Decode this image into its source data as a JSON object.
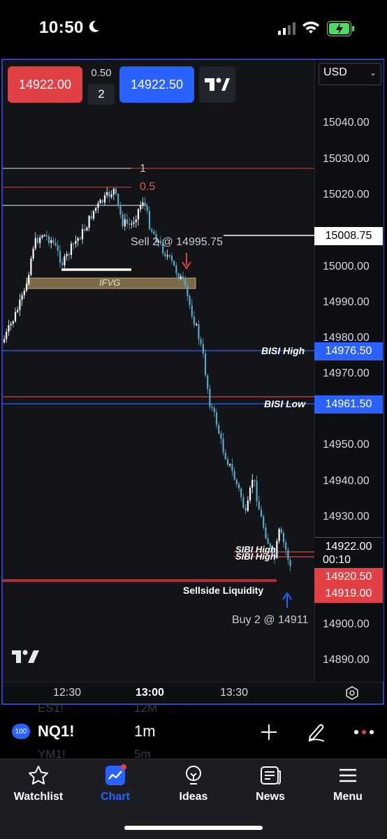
{
  "status_bar": {
    "time": "10:50"
  },
  "trade_panel": {
    "sell_price": "14922.00",
    "spread": "0.50",
    "quantity": "2",
    "buy_price": "14922.50",
    "currency": "USD"
  },
  "price_axis": {
    "ticks": [
      "15040.00",
      "15030.00",
      "15020.00",
      "15000.00",
      "14990.00",
      "14980.00",
      "14970.00",
      "14950.00",
      "14940.00",
      "14930.00",
      "14900.00",
      "14890.00"
    ],
    "last_price": "15008.75",
    "bisi_high_price": "14976.50",
    "bisi_low_price": "14961.50",
    "current_price": "14922.00",
    "countdown": "00:10",
    "sell_price_tag": "14920.50",
    "buy_price_tag": "14919.00"
  },
  "time_axis": {
    "ticks": [
      "12:30",
      "13:00",
      "13:30"
    ]
  },
  "annotations": {
    "fib_1": "1",
    "fib_05": "0.5",
    "sell_order": "Sell 2 @ 14995.75",
    "ifvg": "IFVG",
    "bisi_high": "BISI High",
    "bisi_low": "BISI Low",
    "sibi_high": "SIBI High",
    "sibi_low": "SIBI High",
    "sellside": "Sellside Liquidity",
    "buy_order": "Buy 2 @ 14911"
  },
  "symbol_bar": {
    "badge": "100",
    "symbol": "NQ1!",
    "interval": "1m",
    "ghost_symbol_top": "ES1!",
    "ghost_interval_top": "12M",
    "ghost_symbol_bottom": "YM1!",
    "ghost_interval_bottom": "5m"
  },
  "nav": {
    "items": [
      {
        "label": "Watchlist",
        "icon": "star-icon"
      },
      {
        "label": "Chart",
        "icon": "chart-icon"
      },
      {
        "label": "Ideas",
        "icon": "ideas-icon"
      },
      {
        "label": "News",
        "icon": "news-icon"
      },
      {
        "label": "Menu",
        "icon": "menu-icon"
      }
    ],
    "active": "Chart"
  },
  "colors": {
    "sell": "#e14045",
    "buy": "#2962ff",
    "frame": "#2f44c2",
    "candle_up": "#ffffff",
    "candle_down": "#5aa7c8"
  }
}
